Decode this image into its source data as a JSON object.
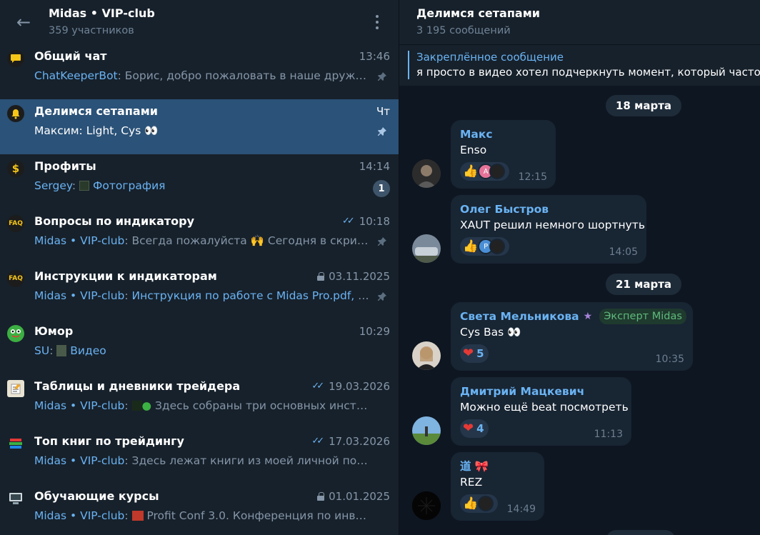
{
  "left_header": {
    "title": "Midas • VIP-club",
    "subtitle": "359 участников"
  },
  "topics": [
    {
      "name": "Общий чат",
      "time": "13:46",
      "sender": "ChatKeeperBot",
      "preview": "Борис, добро пожаловать в наше дружно...",
      "icon": "speech-bubble-icon",
      "icon_color": "#f5c518",
      "pinned": true
    },
    {
      "name": "Делимся сетапами",
      "time": "Чт",
      "sender": "Максим",
      "preview": "Light, Cys 👀",
      "icon": "bell-icon",
      "icon_color": "#f5c518",
      "pinned": true,
      "active": true
    },
    {
      "name": "Профиты",
      "time": "14:14",
      "sender": "Sergey",
      "preview": "Фотография",
      "icon": "dollar-icon",
      "icon_color": "#f5c518",
      "badge": "1"
    },
    {
      "name": "Вопросы по индикатору",
      "time": "10:18",
      "sender": "Midas • VIP-club",
      "preview": "Всегда пожалуйста 🙌 Сегодня в скринер...",
      "icon": "faq-icon",
      "icon_label": "FAQ",
      "read": true,
      "pinned": true
    },
    {
      "name": "Инструкции к индикаторам",
      "time": "03.11.2025",
      "sender": "Midas • VIP-club",
      "preview": "Инструкция по работе с Midas Pro.pdf, На...",
      "icon": "faq-icon",
      "icon_label": "FAQ",
      "locked": true,
      "pinned": true
    },
    {
      "name": "Юмор",
      "time": "10:29",
      "sender": "SU",
      "preview": "Видео",
      "icon": "frog-icon",
      "icon_color": "#3cb043"
    },
    {
      "name": "Таблицы и дневники трейдера",
      "time": "19.03.2026",
      "sender": "Midas • VIP-club",
      "preview": "Здесь собраны три основных инструмент...",
      "icon": "memo-icon",
      "read": true
    },
    {
      "name": "Топ книг по трейдингу",
      "time": "17.03.2026",
      "sender": "Midas • VIP-club",
      "preview": "Здесь лежат книги из моей личной подборки ...",
      "icon": "books-icon",
      "read": true
    },
    {
      "name": "Обучающие курсы",
      "time": "01.01.2025",
      "sender": "Midas • VIP-club",
      "preview": "Profit Conf 3.0. Конференция по инвестиц...",
      "icon": "computer-icon",
      "locked": true
    }
  ],
  "chat_header": {
    "title": "Делимся сетапами",
    "subtitle": "3 195 сообщений"
  },
  "pinned_message": {
    "title": "Закреплённое сообщение",
    "text": "я просто в видео хотел подчеркнуть момент, который часто п"
  },
  "dates": [
    "18 марта",
    "21 марта"
  ],
  "messages": [
    {
      "author": "Макс",
      "author_color": "#6ab3f3",
      "text": "Enso",
      "time": "12:15",
      "reaction": "👍",
      "reactor_initial": "A"
    },
    {
      "author": "Олег Быстров",
      "author_color": "#6ab3f3",
      "text": "XAUT решил немного шортнуть",
      "time": "14:05",
      "reaction": "👍",
      "reactor_initial": "P"
    },
    {
      "author": "Света Мельникова",
      "author_color": "#6ab3f3",
      "badge": "Эксперт Midas",
      "text": "Cys Bas 👀",
      "time": "10:35",
      "reaction": "❤",
      "reaction_count": "5"
    },
    {
      "author": "Дмитрий Мацкевич",
      "author_color": "#6ab3f3",
      "text": "Можно ещё beat посмотреть",
      "time": "11:13",
      "reaction": "❤",
      "reaction_count": "4"
    },
    {
      "author": "道 🎀",
      "author_color": "#6ab3f3",
      "text": "REZ",
      "time": "14:49",
      "reaction": "👍"
    }
  ]
}
